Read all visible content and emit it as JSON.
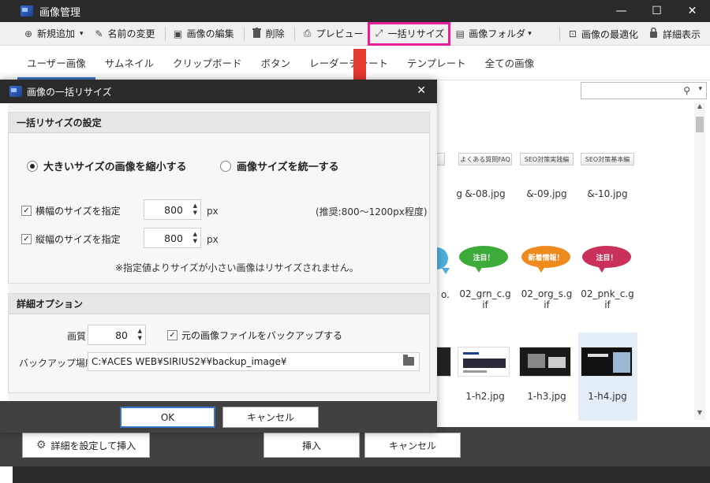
{
  "window": {
    "title": "画像管理",
    "controls": {
      "minimize": "—",
      "maximize": "☐",
      "close": "✕"
    }
  },
  "toolbar": {
    "items": [
      {
        "label": "新規追加",
        "icon": "plus-circle-icon",
        "glyph": "⊕",
        "suffix": "▾"
      },
      {
        "label": "名前の変更",
        "icon": "pencil-icon",
        "glyph": "✎"
      },
      {
        "label": "画像の編集",
        "icon": "image-edit-icon",
        "glyph": "▣"
      },
      {
        "label": "削除",
        "icon": "trash-icon",
        "glyph": "🗑"
      },
      {
        "label": "プレビュー",
        "icon": "preview-icon",
        "glyph": "⎙"
      },
      {
        "label": "一括リサイズ",
        "icon": "resize-icon",
        "glyph": "⤢"
      },
      {
        "label": "画像フォルダ",
        "icon": "image-folder-icon",
        "glyph": "▤",
        "suffix": "▾"
      }
    ],
    "right_items": [
      {
        "label": "画像の最適化",
        "icon": "optimize-icon",
        "glyph": "⊡"
      },
      {
        "label": "詳細表示",
        "icon": "lock-icon",
        "glyph": "🔒"
      }
    ]
  },
  "tabs": [
    "ユーザー画像",
    "サムネイル",
    "クリップボード",
    "ボタン",
    "レーダーチャート",
    "テンプレート",
    "全ての画像"
  ],
  "search": {
    "placeholder": "",
    "icon": "search-icon"
  },
  "grid": {
    "row1": [
      {
        "button_text": "",
        "caption": "g"
      },
      {
        "button_text": "よくある質問FAQ",
        "caption": "&-08.jpg"
      },
      {
        "button_text": "SEO対策実践編",
        "caption": "&-09.jpg"
      },
      {
        "button_text": "SEO対策基本編",
        "caption": "&-10.jpg"
      }
    ],
    "row2": [
      {
        "bubble_text": "",
        "color": "#4fb0d8",
        "caption": "o."
      },
      {
        "bubble_text": "注目！",
        "color": "#3dab3a",
        "caption": "02_grn_c.g\nif"
      },
      {
        "bubble_text": "新着情報！",
        "color": "#ef8a1f",
        "caption": "02_org_s.g\nif"
      },
      {
        "bubble_text": "注目！",
        "color": "#c9305a",
        "caption": "02_pnk_c.g\nif"
      }
    ],
    "row3": [
      {
        "caption": ""
      },
      {
        "caption": "1-h2.jpg"
      },
      {
        "caption": "1-h3.jpg"
      },
      {
        "caption": "1-h4.jpg"
      }
    ]
  },
  "bottom": {
    "detail_insert": "詳細を設定して挿入",
    "insert": "挿入",
    "cancel": "キャンセル"
  },
  "dialog": {
    "title": "画像の一括リサイズ",
    "close": "✕",
    "group1": {
      "title": "一括リサイズの設定",
      "radio_shrink": "大きいサイズの画像を縮小する",
      "radio_unify": "画像サイズを統一する",
      "width_label": "横幅のサイズを指定",
      "width_value": "800",
      "height_label": "縦幅のサイズを指定",
      "height_value": "800",
      "unit": "px",
      "recommend": "(推奨:800〜1200px程度)",
      "note": "※指定値よりサイズが小さい画像はリサイズされません。"
    },
    "group2": {
      "title": "詳細オプション",
      "quality_label": "画質",
      "quality_value": "80",
      "backup_check": "元の画像ファイルをバックアップする",
      "backup_label": "バックアップ場所",
      "backup_path": "C:¥ACES WEB¥SIRIUS2¥¥backup_image¥"
    },
    "ok": "OK",
    "cancel": "キャンセル"
  },
  "colors": {
    "highlight": "#e91e9a",
    "arrow": "#e53a2f",
    "title_bar": "#2b2b2b",
    "tab_accent": "#3a75c4"
  }
}
